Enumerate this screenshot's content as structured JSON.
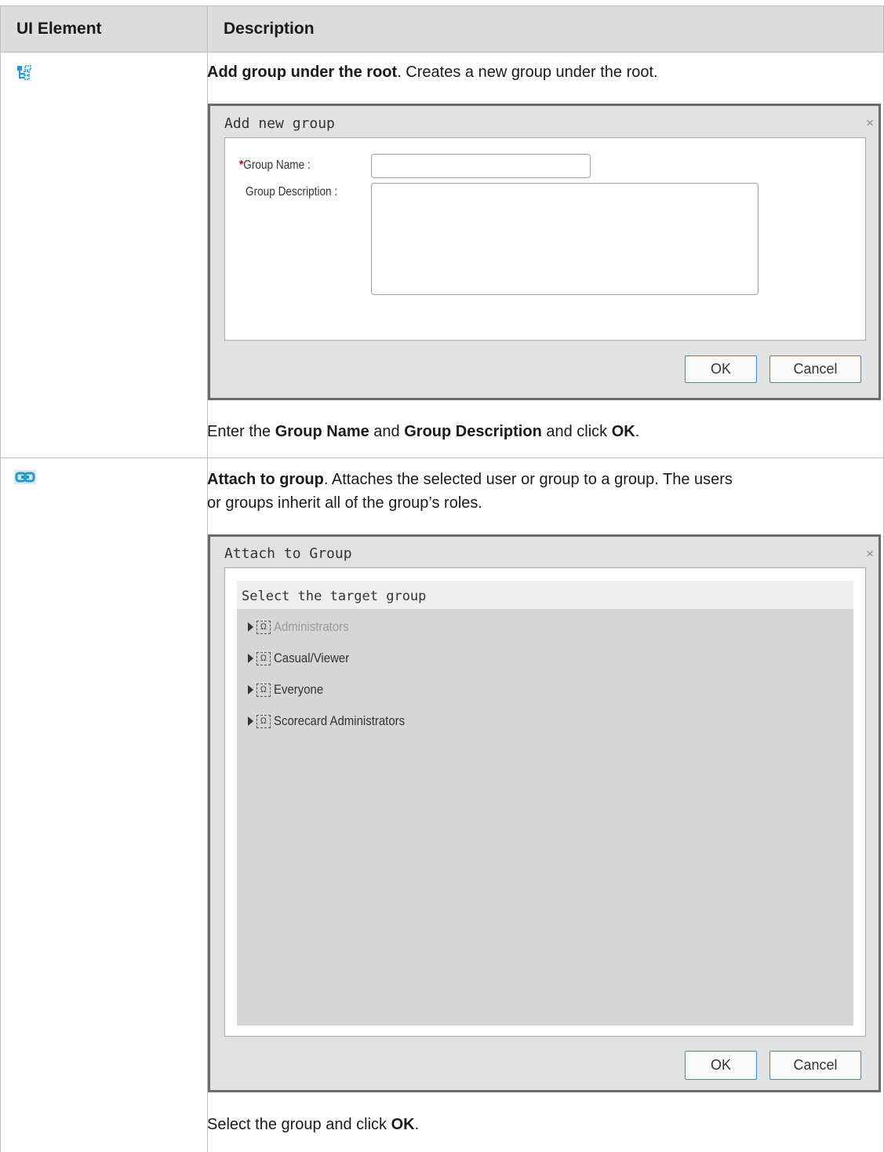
{
  "table": {
    "header_col1": "UI Element",
    "header_col2": "Description"
  },
  "row1": {
    "icon": "add-group-under-root-icon",
    "title": "Add group under the root",
    "desc": ". Creates a new group under the root.",
    "dialog": {
      "title": "Add new group",
      "close": "×",
      "required_mark": "*",
      "group_name_label": "Group Name :",
      "group_name_value": "",
      "group_description_label": "Group Description :",
      "group_description_value": "",
      "ok_label": "OK",
      "cancel_label": "Cancel"
    },
    "footer": {
      "t1": "Enter the ",
      "b1": "Group Name",
      "t2": " and ",
      "b2": "Group Description",
      "t3": " and click ",
      "b3": "OK",
      "t4": "."
    }
  },
  "row2": {
    "icon": "attach-to-group-icon",
    "title": "Attach to group",
    "desc_line1": ". Attaches the selected user or group to a group. The users",
    "desc_line2": "or groups inherit all of the group’s roles.",
    "dialog": {
      "title": "Attach to Group",
      "close": "×",
      "tree_header": "Select the target group",
      "groups": [
        {
          "label": "Administrators",
          "state": "disabled"
        },
        {
          "label": "Casual/Viewer",
          "state": "enabled"
        },
        {
          "label": "Everyone",
          "state": "enabled"
        },
        {
          "label": "Scorecard Administrators",
          "state": "enabled"
        }
      ],
      "ok_label": "OK",
      "cancel_label": "Cancel"
    },
    "footer": {
      "t1": "Select the group and click ",
      "b1": "OK",
      "t2": "."
    }
  },
  "colors": {
    "header_bg": "#dcdcdc",
    "icon_blue": "#1c9ad6",
    "button_border": "#4a86b6",
    "required": "#d10000"
  }
}
